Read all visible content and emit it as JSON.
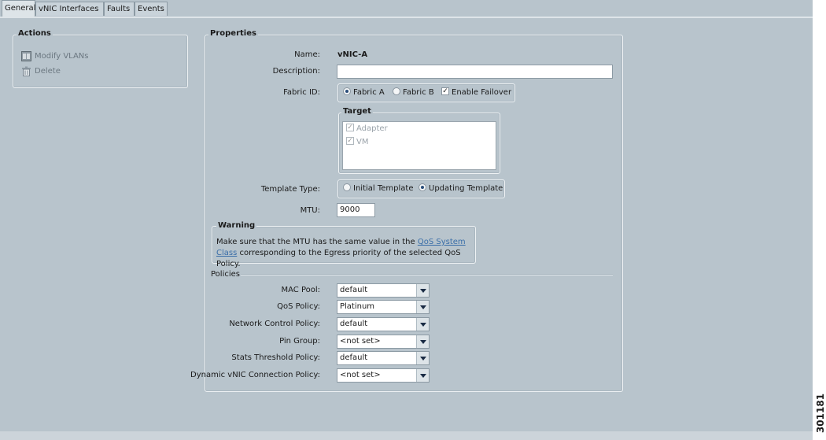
{
  "tabs": [
    "General",
    "vNIC Interfaces",
    "Faults",
    "Events"
  ],
  "actions": {
    "title": "Actions",
    "items": [
      {
        "label": "Modify VLANs",
        "icon": "vlan-icon"
      },
      {
        "label": "Delete",
        "icon": "trash-icon"
      }
    ]
  },
  "properties": {
    "title": "Properties",
    "name_label": "Name:",
    "name_value": "vNIC-A",
    "description_label": "Description:",
    "description_value": "",
    "fabric_label": "Fabric ID:",
    "fabric_a": "Fabric A",
    "fabric_b": "Fabric B",
    "enable_failover": "Enable Failover",
    "target": {
      "title": "Target",
      "items": [
        "Adapter",
        "VM"
      ]
    },
    "template_type_label": "Template Type:",
    "initial_template": "Initial Template",
    "updating_template": "Updating Template",
    "mtu_label": "MTU:",
    "mtu_value": "9000",
    "warning": {
      "title": "Warning",
      "text_before": "Make sure that the MTU has the same value in the ",
      "link": "QoS System Class",
      "text_after": " corresponding to the Egress priority of the selected QoS Policy."
    },
    "policies": {
      "title": "Policies",
      "rows": [
        {
          "label": "MAC Pool:",
          "value": "default"
        },
        {
          "label": "QoS Policy:",
          "value": "Platinum"
        },
        {
          "label": "Network Control Policy:",
          "value": "default"
        },
        {
          "label": "Pin Group:",
          "value": "<not set>"
        },
        {
          "label": "Stats Threshold Policy:",
          "value": "default"
        },
        {
          "label": "Dynamic vNIC Connection Policy:",
          "value": "<not set>"
        }
      ]
    }
  },
  "figure_number": "301181"
}
